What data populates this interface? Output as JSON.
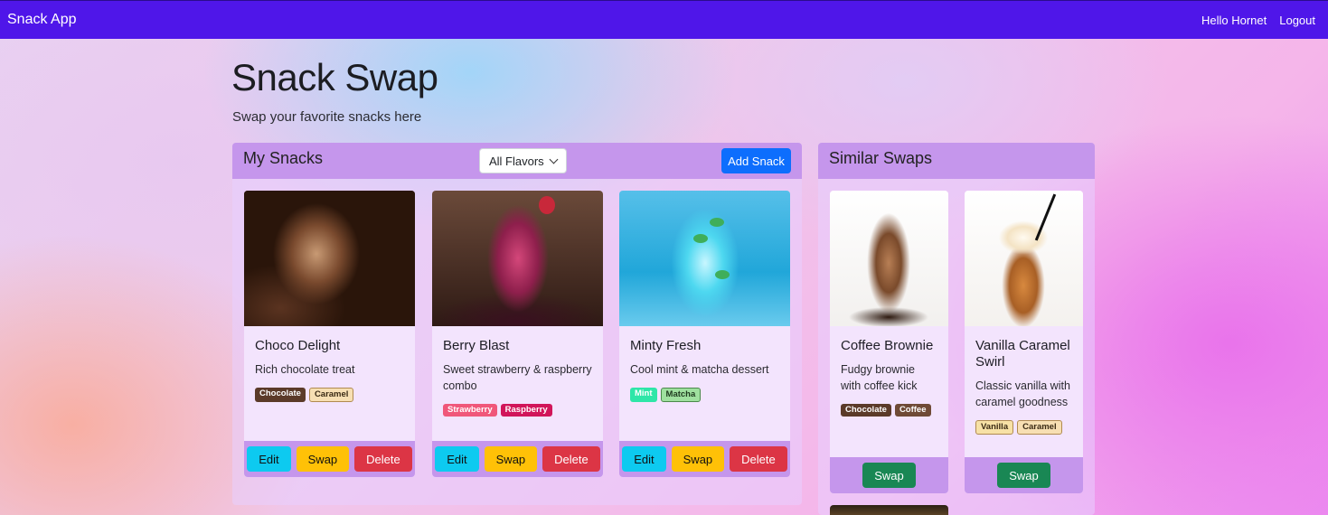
{
  "navbar": {
    "brand": "Snack App",
    "greeting": "Hello Hornet",
    "logout": "Logout",
    "color": "#4f16e9"
  },
  "hero": {
    "title": "Snack Swap",
    "subtitle": "Swap your favorite snacks here"
  },
  "my_snacks": {
    "title": "My Snacks",
    "filter_selected": "All Flavors",
    "add_label": "Add Snack",
    "buttons": {
      "edit": "Edit",
      "swap": "Swap",
      "delete": "Delete"
    },
    "cards": [
      {
        "image": "chocolate-drink-image",
        "title": "Choco Delight",
        "text": "Rich chocolate treat",
        "tags": [
          {
            "label": "Chocolate",
            "bg": "#5b3a29",
            "fg": "#ffffff"
          },
          {
            "label": "Caramel",
            "bg": "#f7dfb3",
            "fg": "#3a2a14"
          }
        ]
      },
      {
        "image": "berry-smoothie-image",
        "title": "Berry Blast",
        "text": "Sweet strawberry & raspberry combo",
        "tags": [
          {
            "label": "Strawberry",
            "bg": "#f0577a",
            "fg": "#ffffff"
          },
          {
            "label": "Raspberry",
            "bg": "#d1155a",
            "fg": "#ffffff"
          }
        ]
      },
      {
        "image": "mint-drink-image",
        "title": "Minty Fresh",
        "text": "Cool mint & matcha dessert",
        "tags": [
          {
            "label": "Mint",
            "bg": "#2ee6a8",
            "fg": "#ffffff"
          },
          {
            "label": "Matcha",
            "bg": "#9fe09f",
            "fg": "#1f3a1f"
          }
        ]
      }
    ]
  },
  "similar_swaps": {
    "title": "Similar Swaps",
    "swap_label": "Swap",
    "cards": [
      {
        "image": "iced-coffee-image",
        "title": "Coffee Brownie",
        "text": "Fudgy brownie with coffee kick",
        "tags": [
          {
            "label": "Chocolate",
            "bg": "#5b3a29",
            "fg": "#ffffff"
          },
          {
            "label": "Coffee",
            "bg": "#6f4a36",
            "fg": "#ffffff"
          }
        ]
      },
      {
        "image": "caramel-frappe-image",
        "title": "Vanilla Caramel Swirl",
        "text": "Classic vanilla with caramel goodness",
        "tags": [
          {
            "label": "Vanilla",
            "bg": "#f7e1a6",
            "fg": "#3a2a14"
          },
          {
            "label": "Caramel",
            "bg": "#f7dfb3",
            "fg": "#3a2a14"
          }
        ]
      }
    ]
  }
}
